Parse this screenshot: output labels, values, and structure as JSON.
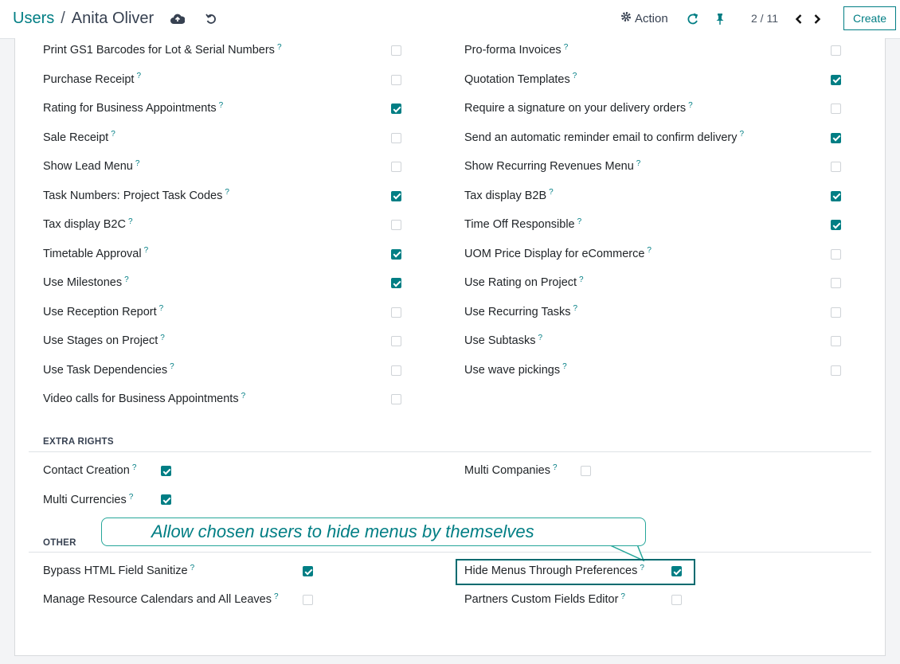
{
  "header": {
    "breadcrumb_parent": "Users",
    "breadcrumb_separator": "/",
    "record_name": "Anita Oliver",
    "action_label": "Action",
    "pager": "2 / 11",
    "create_label": "Create"
  },
  "groups_left": [
    {
      "label": "Print GS1 Barcodes for Lot & Serial Numbers",
      "checked": false
    },
    {
      "label": "Purchase Receipt",
      "checked": false
    },
    {
      "label": "Rating for Business Appointments",
      "checked": true
    },
    {
      "label": "Sale Receipt",
      "checked": false
    },
    {
      "label": "Show Lead Menu",
      "checked": false
    },
    {
      "label": "Task Numbers: Project Task Codes",
      "checked": true
    },
    {
      "label": "Tax display B2C",
      "checked": false
    },
    {
      "label": "Timetable Approval",
      "checked": true
    },
    {
      "label": "Use Milestones",
      "checked": true
    },
    {
      "label": "Use Reception Report",
      "checked": false
    },
    {
      "label": "Use Stages on Project",
      "checked": false
    },
    {
      "label": "Use Task Dependencies",
      "checked": false
    },
    {
      "label": "Video calls for Business Appointments",
      "checked": false
    }
  ],
  "groups_right": [
    {
      "label": "Pro-forma Invoices",
      "checked": false
    },
    {
      "label": "Quotation Templates",
      "checked": true
    },
    {
      "label": "Require a signature on your delivery orders",
      "checked": false
    },
    {
      "label": "Send an automatic reminder email to confirm delivery",
      "checked": true
    },
    {
      "label": "Show Recurring Revenues Menu",
      "checked": false
    },
    {
      "label": "Tax display B2B",
      "checked": true
    },
    {
      "label": "Time Off Responsible",
      "checked": true
    },
    {
      "label": "UOM Price Display for eCommerce",
      "checked": false
    },
    {
      "label": "Use Rating on Project",
      "checked": false
    },
    {
      "label": "Use Recurring Tasks",
      "checked": false
    },
    {
      "label": "Use Subtasks",
      "checked": false
    },
    {
      "label": "Use wave pickings",
      "checked": false
    }
  ],
  "extra_rights": {
    "title": "EXTRA RIGHTS",
    "contact_creation": {
      "label": "Contact Creation",
      "checked": true
    },
    "multi_companies": {
      "label": "Multi Companies",
      "checked": false
    },
    "multi_currencies": {
      "label": "Multi Currencies",
      "checked": true
    }
  },
  "other": {
    "title": "OTHER",
    "bypass_html": {
      "label": "Bypass HTML Field Sanitize",
      "checked": true
    },
    "hide_menus": {
      "label": "Hide Menus Through Preferences",
      "checked": true
    },
    "manage_calendars": {
      "label": "Manage Resource Calendars and All Leaves",
      "checked": false
    },
    "partners_editor": {
      "label": "Partners Custom Fields Editor",
      "checked": false
    }
  },
  "tooltip_marker": "?",
  "callout_text": "Allow chosen users to hide menus by themselves",
  "colors": {
    "accent": "#017e84",
    "callout_border": "#26a69a",
    "highlight": "#016b70"
  }
}
